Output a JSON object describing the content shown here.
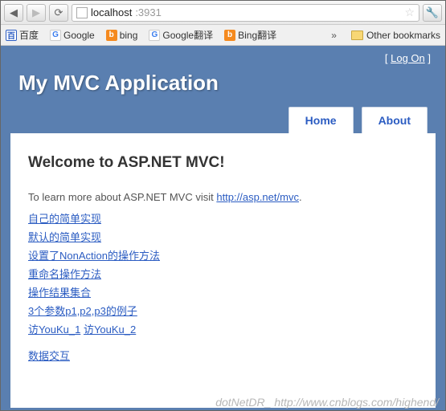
{
  "browser": {
    "url_host": "localhost",
    "url_port": ":3931",
    "bookmarks": {
      "baidu": "百度",
      "google": "Google",
      "bing": "bing",
      "google_translate": "Google翻译",
      "bing_translate": "Bing翻译",
      "other": "Other bookmarks"
    }
  },
  "header": {
    "logon_prefix": "[ ",
    "logon_label": "Log On",
    "logon_suffix": " ]",
    "title": "My MVC Application",
    "menu": {
      "home": "Home",
      "about": "About"
    }
  },
  "content": {
    "heading": "Welcome to ASP.NET MVC!",
    "intro_prefix": "To learn more about ASP.NET MVC visit ",
    "intro_link": "http://asp.net/mvc",
    "intro_suffix": ".",
    "links": {
      "l1": "自己的简单实现",
      "l2": "默认的简单实现",
      "l3": "设置了NonAction的操作方法",
      "l4": "重命名操作方法",
      "l5": "操作结果集合",
      "l6": "3个参数p1,p2,p3的例子",
      "l7a": "访YouKu_1",
      "l7b": "访YouKu_2",
      "l8": "数据交互"
    }
  },
  "watermark": "dotNetDR_  http://www.cnblogs.com/highend/"
}
